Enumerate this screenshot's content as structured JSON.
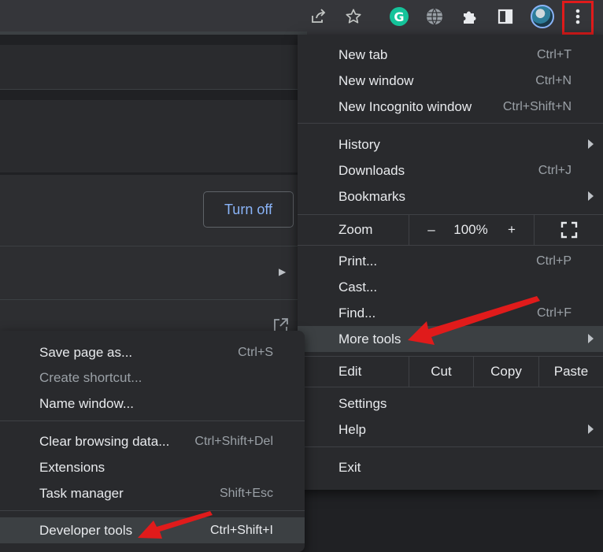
{
  "toolbar": {
    "icons": [
      "share-icon",
      "star-icon",
      "grammarly-icon",
      "globe-icon",
      "extensions-icon",
      "side-panel-icon",
      "avatar",
      "kebab-menu-icon"
    ],
    "grammarly_letter": "G"
  },
  "page": {
    "turn_off_label": "Turn off"
  },
  "main_menu": {
    "new_tab": {
      "label": "New tab",
      "shortcut": "Ctrl+T"
    },
    "new_window": {
      "label": "New window",
      "shortcut": "Ctrl+N"
    },
    "new_incognito": {
      "label": "New Incognito window",
      "shortcut": "Ctrl+Shift+N"
    },
    "history": {
      "label": "History"
    },
    "downloads": {
      "label": "Downloads",
      "shortcut": "Ctrl+J"
    },
    "bookmarks": {
      "label": "Bookmarks"
    },
    "zoom": {
      "label": "Zoom",
      "minus": "–",
      "value": "100%",
      "plus": "+"
    },
    "print": {
      "label": "Print...",
      "shortcut": "Ctrl+P"
    },
    "cast": {
      "label": "Cast..."
    },
    "find": {
      "label": "Find...",
      "shortcut": "Ctrl+F"
    },
    "more_tools": {
      "label": "More tools"
    },
    "edit": {
      "label": "Edit",
      "cut": "Cut",
      "copy": "Copy",
      "paste": "Paste"
    },
    "settings": {
      "label": "Settings"
    },
    "help": {
      "label": "Help"
    },
    "exit": {
      "label": "Exit"
    }
  },
  "sub_menu": {
    "save_page": {
      "label": "Save page as...",
      "shortcut": "Ctrl+S"
    },
    "create_shortcut": {
      "label": "Create shortcut..."
    },
    "name_window": {
      "label": "Name window..."
    },
    "clear_data": {
      "label": "Clear browsing data...",
      "shortcut": "Ctrl+Shift+Del"
    },
    "extensions": {
      "label": "Extensions"
    },
    "task_manager": {
      "label": "Task manager",
      "shortcut": "Shift+Esc"
    },
    "developer_tools": {
      "label": "Developer tools",
      "shortcut": "Ctrl+Shift+I"
    }
  },
  "colors": {
    "menu_bg": "#292a2d",
    "highlight": "#3c4043",
    "accent": "#8ab4f8",
    "annotation_red": "#e01b1b"
  }
}
